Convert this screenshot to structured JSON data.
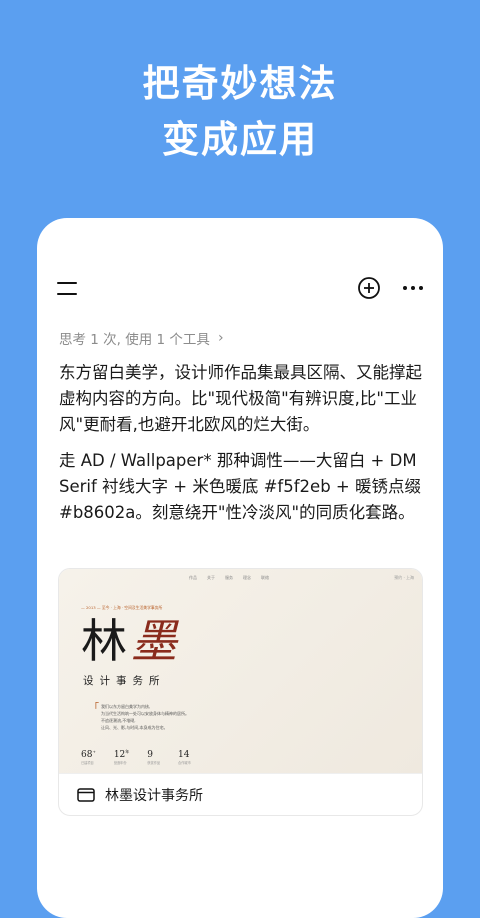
{
  "hero": {
    "line1": "把奇妙想法",
    "line2": "变成应用"
  },
  "toolbar": {
    "menu_icon": "menu-icon",
    "add_icon": "plus-circle-icon",
    "more_icon": "more-horizontal-icon"
  },
  "thinking": {
    "label": "思考 1 次, 使用 1 个工具",
    "chevron": "›"
  },
  "message": {
    "p1": "东方留白美学，设计师作品集最具区隔、又能撑起虚构内容的方向。比\"现代极简\"有辨识度,比\"工业风\"更耐看,也避开北欧风的烂大街。",
    "p2": "走 AD / Wallpaper* 那种调性——大留白 + DM Serif 衬线大字 + 米色暖底 #f5f2eb + 暖锈点缀 #b8602a。刻意绕开\"性冷淡风\"的同质化套路。"
  },
  "preview": {
    "nav": [
      "作品",
      "关于",
      "服务",
      "理念",
      "联络"
    ],
    "nav_right": "预约 · 上海",
    "subtitle": "— 2013 — 至今 · 上海 · 空间及生活美学事务所",
    "name_char1": "林",
    "name_char2": "墨",
    "tagline": "设计事务所",
    "quote_mark": "「",
    "lines": [
      "我们以东方留白美学为内核,",
      "为当代生活构筑一处可以安放身体与精神的居所。",
      "不追逐潮流,不堆砌,",
      "让风、光、影,与时间,本身成为住宅。"
    ],
    "stats": [
      {
        "value": "68",
        "unit": "+",
        "label": "已建项目"
      },
      {
        "value": "12",
        "unit": "年",
        "label": "营造年份"
      },
      {
        "value": "9",
        "unit": "",
        "label": "获奖作品"
      },
      {
        "value": "14",
        "unit": "",
        "label": "合作城市"
      }
    ]
  },
  "card": {
    "icon": "browser-window-icon",
    "title": "林墨设计事务所"
  },
  "colors": {
    "background": "#5b9ff0",
    "accent": "#b8602a",
    "ink_red": "#8a2b1c",
    "paper": "#f5f2eb"
  }
}
